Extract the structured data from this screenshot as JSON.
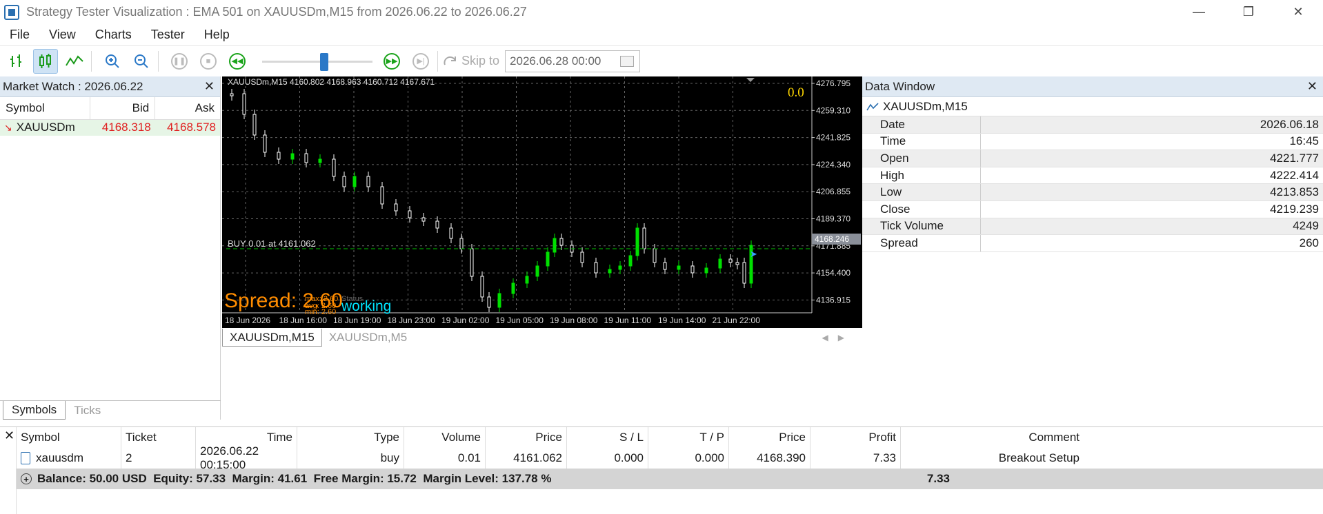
{
  "window": {
    "title": "Strategy Tester Visualization : EMA 501 on XAUUSDm,M15 from 2026.06.22 to 2026.06.27"
  },
  "menu": [
    "File",
    "View",
    "Charts",
    "Tester",
    "Help"
  ],
  "toolbar": {
    "skip_label": "Skip to",
    "skip_date": "2026.06.28 00:00"
  },
  "market_watch": {
    "title": "Market Watch : 2026.06.22",
    "columns": [
      "Symbol",
      "Bid",
      "Ask"
    ],
    "rows": [
      {
        "symbol": "XAUUSDm",
        "bid": "4168.318",
        "ask": "4168.578"
      }
    ],
    "tabs": [
      "Symbols",
      "Ticks"
    ]
  },
  "chart": {
    "header": "XAUUSDm,M15  4160.802 4168.963 4160.712 4167.671",
    "corner_value": "0.0",
    "order_label": "BUY 0.01 at 4161.062",
    "current_price": "4168.246",
    "y_ticks": [
      "4276.795",
      "4259.310",
      "4241.825",
      "4224.340",
      "4206.855",
      "4189.370",
      "4171.885",
      "4154.400",
      "4136.915"
    ],
    "x_ticks": [
      "18 Jun 2026",
      "18 Jun 16:00",
      "18 Jun 19:00",
      "18 Jun 23:00",
      "19 Jun 02:00",
      "19 Jun 05:00",
      "19 Jun 08:00",
      "19 Jun 11:00",
      "19 Jun 14:00",
      "21 Jun 22:00"
    ],
    "spread_text": "Spread: 2.60",
    "max_text": "max: 2.60",
    "avg_text": "avg: 2.60",
    "min_text": "min: 2.60",
    "status_label": "Status",
    "status_text": "working",
    "tabs": [
      "XAUUSDm,M15",
      "XAUUSDm,M5"
    ],
    "colors": {
      "bull": "#00e000",
      "bear": "#ffffff",
      "spread": "#ff8c00",
      "status": "#00e5ff",
      "corner": "#ffd700"
    }
  },
  "data_window": {
    "title": "Data Window",
    "symbol": "XAUUSDm,M15",
    "rows": [
      {
        "label": "Date",
        "value": "2026.06.18"
      },
      {
        "label": "Time",
        "value": "16:45"
      },
      {
        "label": "Open",
        "value": "4221.777"
      },
      {
        "label": "High",
        "value": "4222.414"
      },
      {
        "label": "Low",
        "value": "4213.853"
      },
      {
        "label": "Close",
        "value": "4219.239"
      },
      {
        "label": "Tick Volume",
        "value": "4249"
      },
      {
        "label": "Spread",
        "value": "260"
      }
    ]
  },
  "terminal": {
    "columns": [
      "Symbol",
      "Ticket",
      "Time",
      "Type",
      "Volume",
      "Price",
      "S / L",
      "T / P",
      "Price",
      "Profit",
      "Comment"
    ],
    "rows": [
      {
        "symbol": "xauusdm",
        "ticket": "2",
        "time": "2026.06.22 00:15:00",
        "type": "buy",
        "volume": "0.01",
        "price": "4161.062",
        "sl": "0.000",
        "tp": "0.000",
        "price2": "4168.390",
        "profit": "7.33",
        "comment": "Breakout Setup"
      }
    ],
    "summary": "Balance: 50.00 USD  Equity: 57.33  Margin: 41.61  Free Margin: 15.72  Margin Level: 137.78 %",
    "summary_profit": "7.33"
  }
}
